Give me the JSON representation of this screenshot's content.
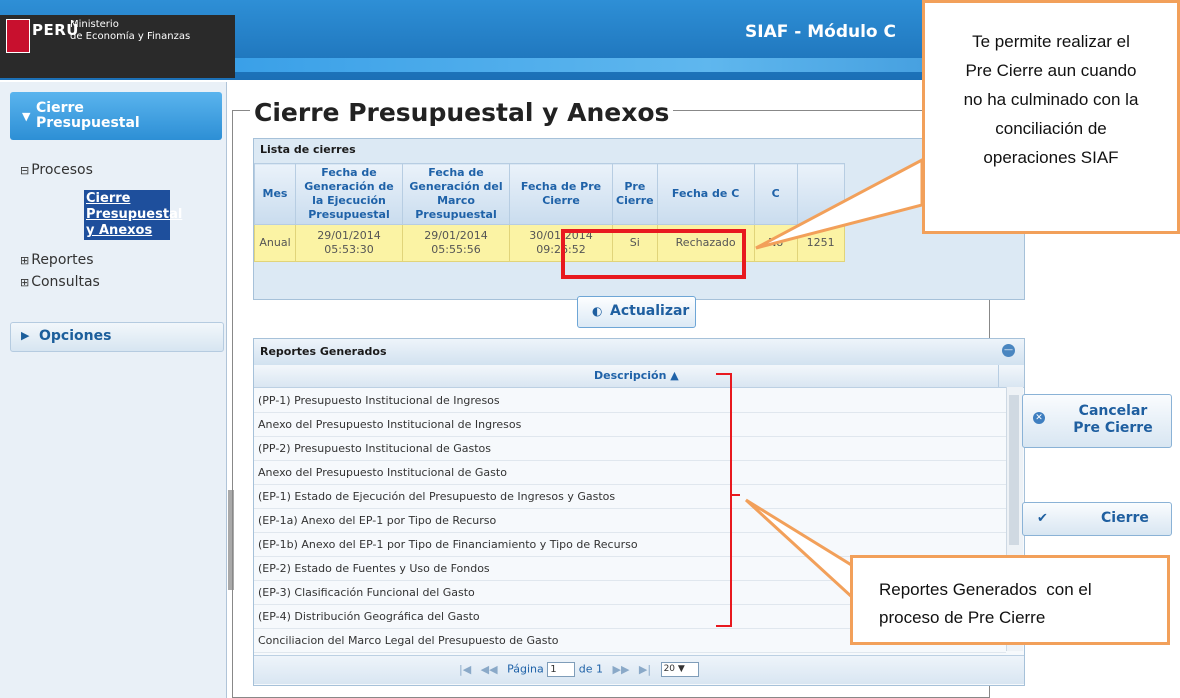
{
  "header": {
    "flag_label": "PERÚ",
    "ministry_line1": "Ministerio",
    "ministry_line2": "de Economía y Finanzas",
    "title": "SIAF - Módulo C"
  },
  "sidebar": {
    "cierre_section": "Cierre Presupuestal",
    "tree": {
      "procesos": "Procesos",
      "selected_item": "Cierre Presupuestal y Anexos",
      "reportes": "Reportes",
      "consultas": "Consultas"
    },
    "opciones_section": "Opciones"
  },
  "main": {
    "title": "Cierre Presupuestal y Anexos",
    "lista": {
      "title": "Lista de cierres",
      "headers": [
        "Mes",
        "Fecha de Generación de la Ejecución Presupuestal",
        "Fecha de Generación del Marco Presupuestal",
        "Fecha de Pre Cierre",
        "Pre Cierre",
        "Fecha de C",
        "C",
        ""
      ],
      "row": [
        "Anual",
        "29/01/2014 05:53:30",
        "29/01/2014 05:55:56",
        "30/01/2014 09:26:52",
        "Si",
        "Rechazado",
        "No",
        "1251"
      ]
    },
    "actualizar_label": "Actualizar",
    "reportes": {
      "title": "Reportes Generados",
      "column": "Descripción",
      "rows": [
        "(PP-1) Presupuesto Institucional de Ingresos",
        "Anexo del Presupuesto Institucional de Ingresos",
        "(PP-2) Presupuesto Institucional de Gastos",
        "Anexo del Presupuesto Institucional de Gasto",
        "(EP-1) Estado de Ejecución del Presupuesto de Ingresos y Gastos",
        "(EP-1a) Anexo del EP-1 por Tipo de Recurso",
        "(EP-1b) Anexo del EP-1 por Tipo de Financiamiento y Tipo de Recurso",
        "(EP-2) Estado de Fuentes y Uso de Fondos",
        "(EP-3) Clasificación Funcional del Gasto",
        "(EP-4) Distribución Geográfica del Gasto",
        "Conciliacion del Marco Legal del Presupuesto de Gasto"
      ],
      "pager": {
        "page_label": "Página",
        "page_value": "1",
        "of_label": "de 1",
        "page_size": "20"
      }
    }
  },
  "actions": {
    "cancelar_line1": "Cancelar",
    "cancelar_line2": "Pre Cierre",
    "cierre": "Cierre"
  },
  "callouts": {
    "top": [
      "Te permite realizar el",
      "Pre Cierre aun cuando",
      "no ha culminado con la",
      "conciliación de",
      "operaciones SIAF"
    ],
    "bottom": [
      "Reportes Generados  con el",
      "proceso de Pre Cierre"
    ]
  },
  "colors": {
    "header_blue": "#1b6fb6",
    "row_highlight": "#fbf3a4",
    "annotation_red": "#e8191f",
    "callout_border": "#f2a05a"
  }
}
